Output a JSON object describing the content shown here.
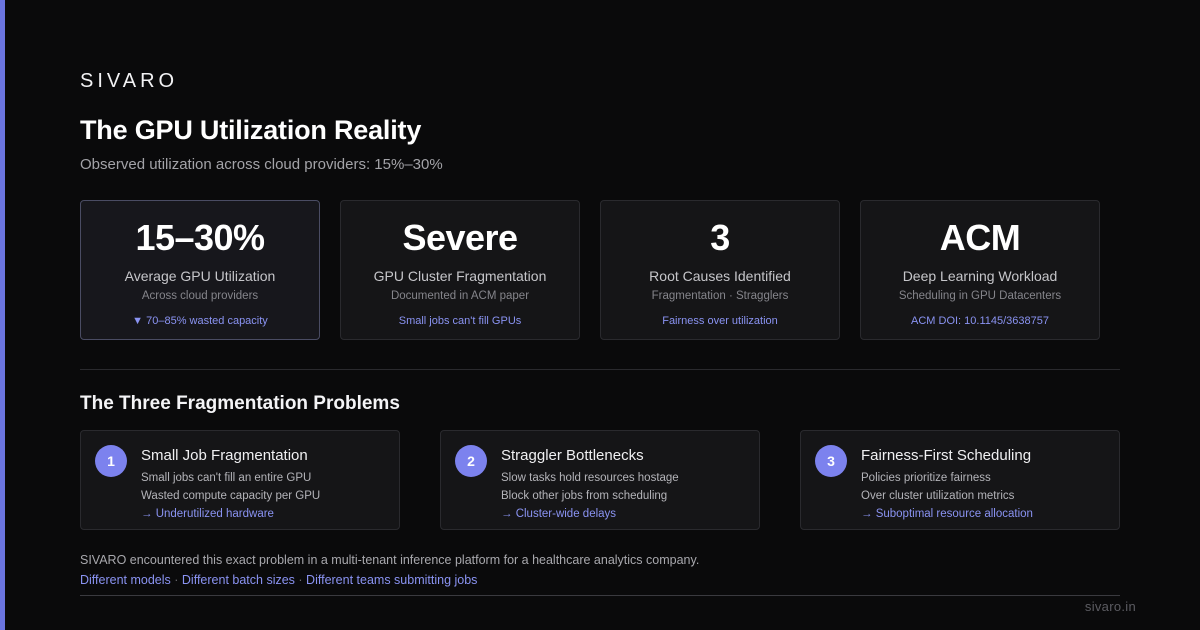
{
  "brand": "SIVARO",
  "title": "The GPU Utilization Reality",
  "subtitle": "Observed utilization across cloud providers: 15%–30%",
  "colors": {
    "accent": "#6b75e0",
    "link": "#8a93f2",
    "badge": "#7c82ee",
    "background": "#0a0a0b"
  },
  "stats": [
    {
      "value": "15–30%",
      "label": "Average GPU Utilization",
      "sub": "Across cloud providers",
      "note": "▼ 70–85% wasted capacity"
    },
    {
      "value": "Severe",
      "label": "GPU Cluster Fragmentation",
      "sub": "Documented in ACM paper",
      "note": "Small jobs can't fill GPUs"
    },
    {
      "value": "3",
      "label": "Root Causes Identified",
      "sub": "Fragmentation · Stragglers",
      "note": "Fairness over utilization"
    },
    {
      "value": "ACM",
      "label": "Deep Learning Workload",
      "sub": "Scheduling in GPU Datacenters",
      "note": "ACM DOI: 10.1145/3638757"
    }
  ],
  "section_title": "The Three Fragmentation Problems",
  "problems": [
    {
      "number": "1",
      "title": "Small Job Fragmentation",
      "line1": "Small jobs can't fill an entire GPU",
      "line2": "Wasted compute capacity per GPU",
      "result": "→ Underutilized hardware"
    },
    {
      "number": "2",
      "title": "Straggler Bottlenecks",
      "line1": "Slow tasks hold resources hostage",
      "line2": "Block other jobs from scheduling",
      "result": "→ Cluster-wide delays"
    },
    {
      "number": "3",
      "title": "Fairness-First Scheduling",
      "line1": "Policies prioritize fairness",
      "line2": "Over cluster utilization metrics",
      "result": "→ Suboptimal resource allocation"
    }
  ],
  "footer": {
    "text": "SIVARO encountered this exact problem in a multi-tenant inference platform for a healthcare analytics company.",
    "links": [
      "Different models",
      "Different batch sizes",
      "Different teams submitting jobs"
    ],
    "separator": " · ",
    "site": "sivaro.in"
  }
}
